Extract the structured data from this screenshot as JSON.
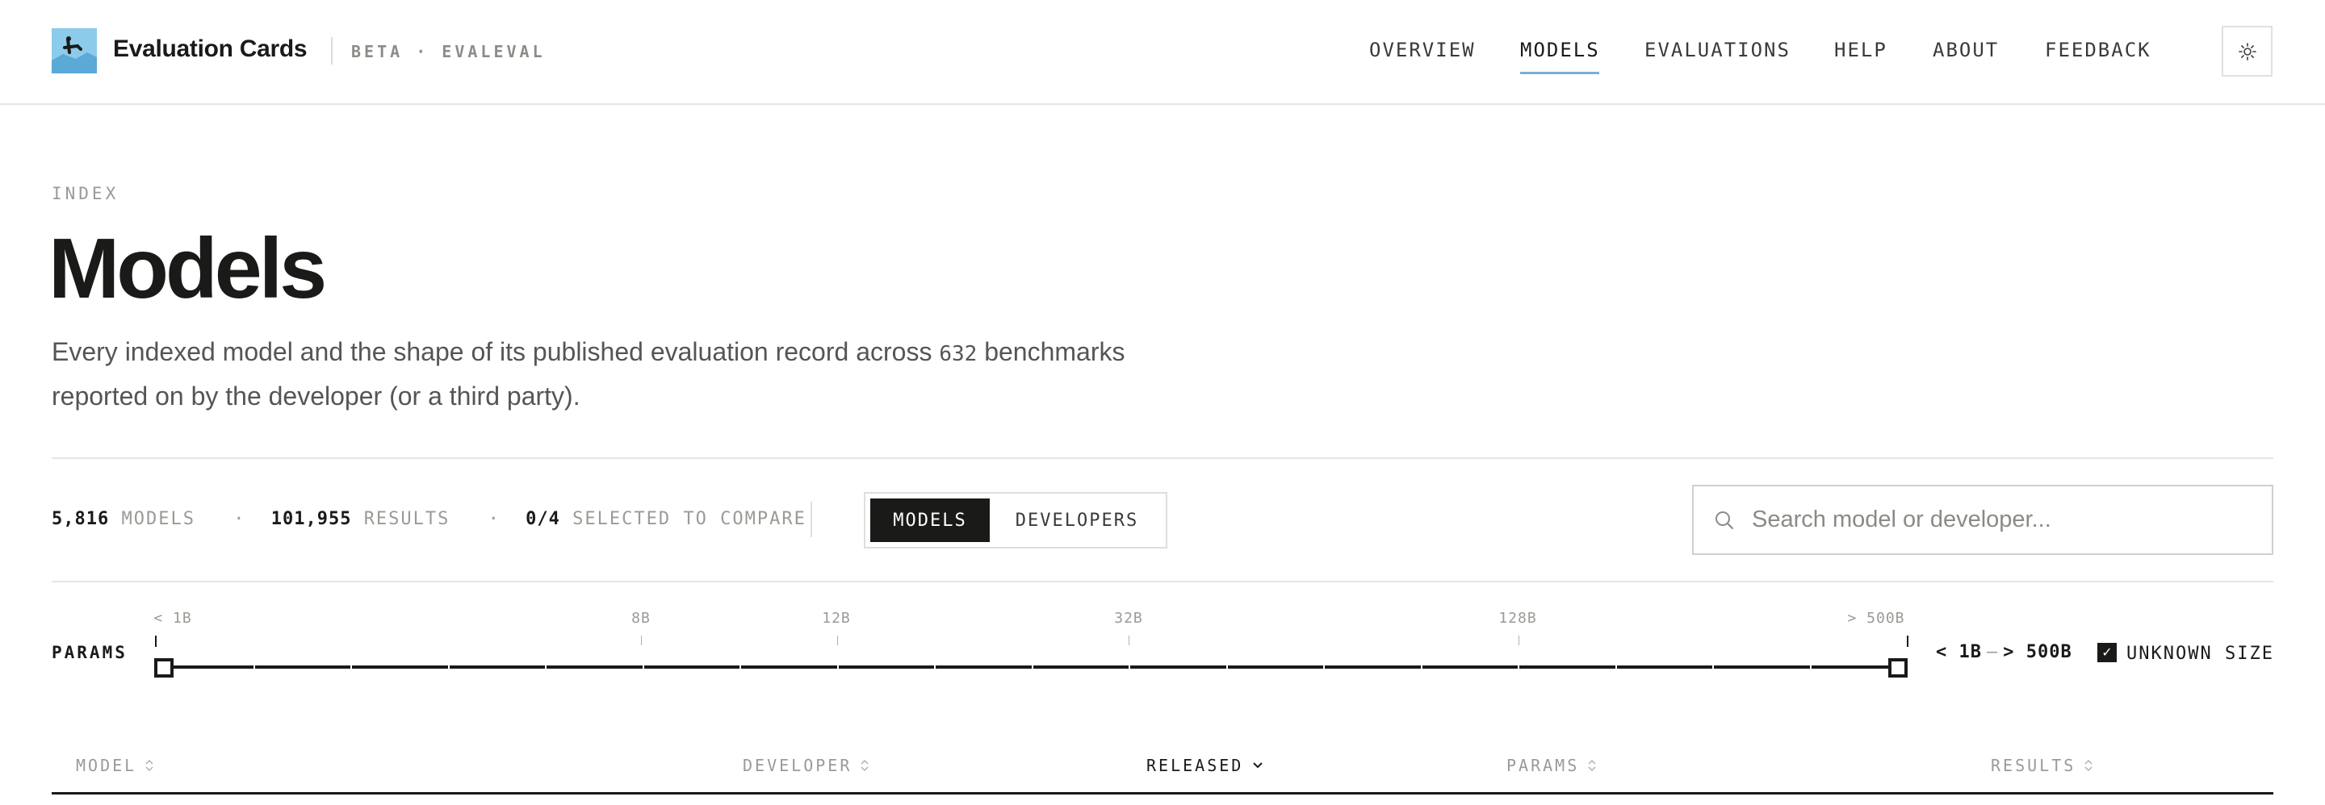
{
  "header": {
    "brand": "Evaluation Cards",
    "beta": "BETA · EVALEVAL",
    "nav": [
      {
        "label": "OVERVIEW",
        "active": false
      },
      {
        "label": "MODELS",
        "active": true
      },
      {
        "label": "EVALUATIONS",
        "active": false
      },
      {
        "label": "HELP",
        "active": false
      },
      {
        "label": "ABOUT",
        "active": false
      },
      {
        "label": "FEEDBACK",
        "active": false
      }
    ],
    "theme_icon": "sun-icon",
    "accent_color": "#7aaed6",
    "logo_color": "#8ccbea"
  },
  "hero": {
    "eyebrow": "INDEX",
    "title": "Models",
    "desc_prefix": "Every indexed model and the shape of its published evaluation record across",
    "benchmark_count": "632",
    "desc_suffix": "benchmarks reported on by the developer (or a third party)."
  },
  "stats": {
    "models_count": "5,816",
    "models_label": "MODELS",
    "results_count": "101,955",
    "results_label": "RESULTS",
    "compare_count": "0/4",
    "compare_label": "SELECTED TO COMPARE",
    "separator": "·"
  },
  "view_toggle": {
    "options": [
      "MODELS",
      "DEVELOPERS"
    ],
    "selected": "MODELS"
  },
  "search": {
    "placeholder": "Search model or developer...",
    "value": ""
  },
  "params_filter": {
    "label": "PARAMS",
    "ticks": [
      "< 1B",
      "8B",
      "12B",
      "32B",
      "128B",
      "> 500B"
    ],
    "range_min": "< 1B",
    "range_sep": "–",
    "range_max": "> 500B",
    "unknown_label": "UNKNOWN SIZE",
    "unknown_checked": true
  },
  "table": {
    "columns": [
      {
        "label": "MODEL",
        "sort": "none"
      },
      {
        "label": "DEVELOPER",
        "sort": "none"
      },
      {
        "label": "RELEASED",
        "sort": "desc"
      },
      {
        "label": "PARAMS",
        "sort": "none"
      },
      {
        "label": "RESULTS",
        "sort": "none"
      }
    ]
  }
}
